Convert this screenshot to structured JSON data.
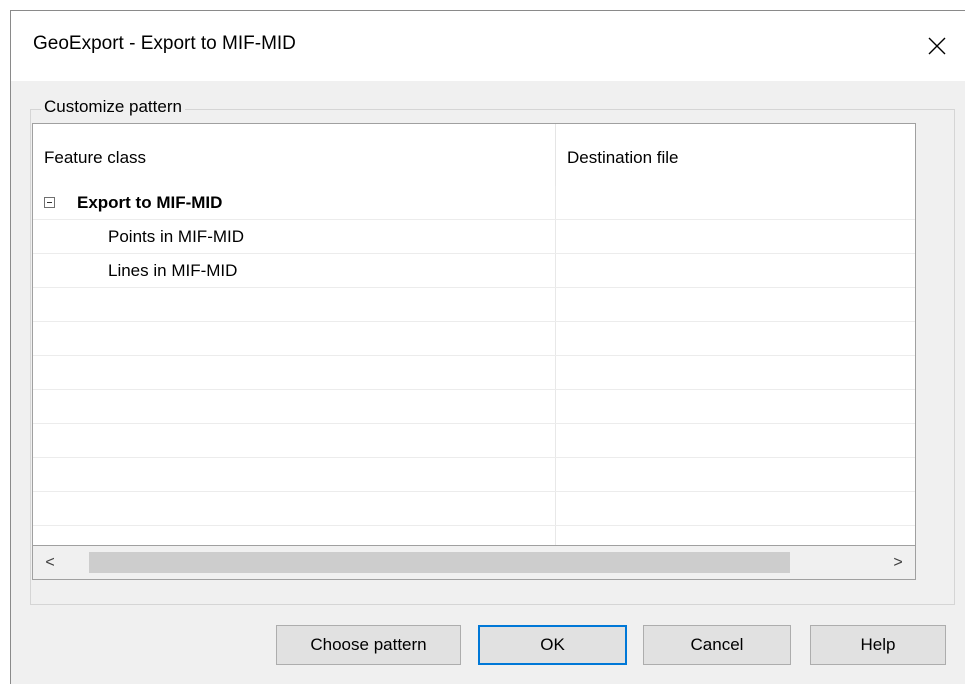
{
  "window": {
    "title": "GeoExport - Export to MIF-MID"
  },
  "group": {
    "label": "Customize pattern"
  },
  "grid": {
    "columns": [
      "Feature class",
      "Destination file"
    ],
    "rows": [
      {
        "label": "Export to MIF-MID",
        "destination": "",
        "level": 0,
        "expanded": true
      },
      {
        "label": "Points in MIF-MID",
        "destination": "",
        "level": 1
      },
      {
        "label": "Lines in MIF-MID",
        "destination": "",
        "level": 1
      }
    ]
  },
  "scrollbar": {
    "left_arrow": "<",
    "right_arrow": ">"
  },
  "buttons": {
    "choose_pattern": "Choose pattern",
    "ok": "OK",
    "cancel": "Cancel",
    "help": "Help"
  },
  "colors": {
    "accent": "#0078d7",
    "button_face": "#e1e1e1",
    "dialog_bg": "#f0f0f0"
  },
  "icons": {
    "close": "close-icon",
    "tree_toggle": "collapse-minus-icon"
  }
}
